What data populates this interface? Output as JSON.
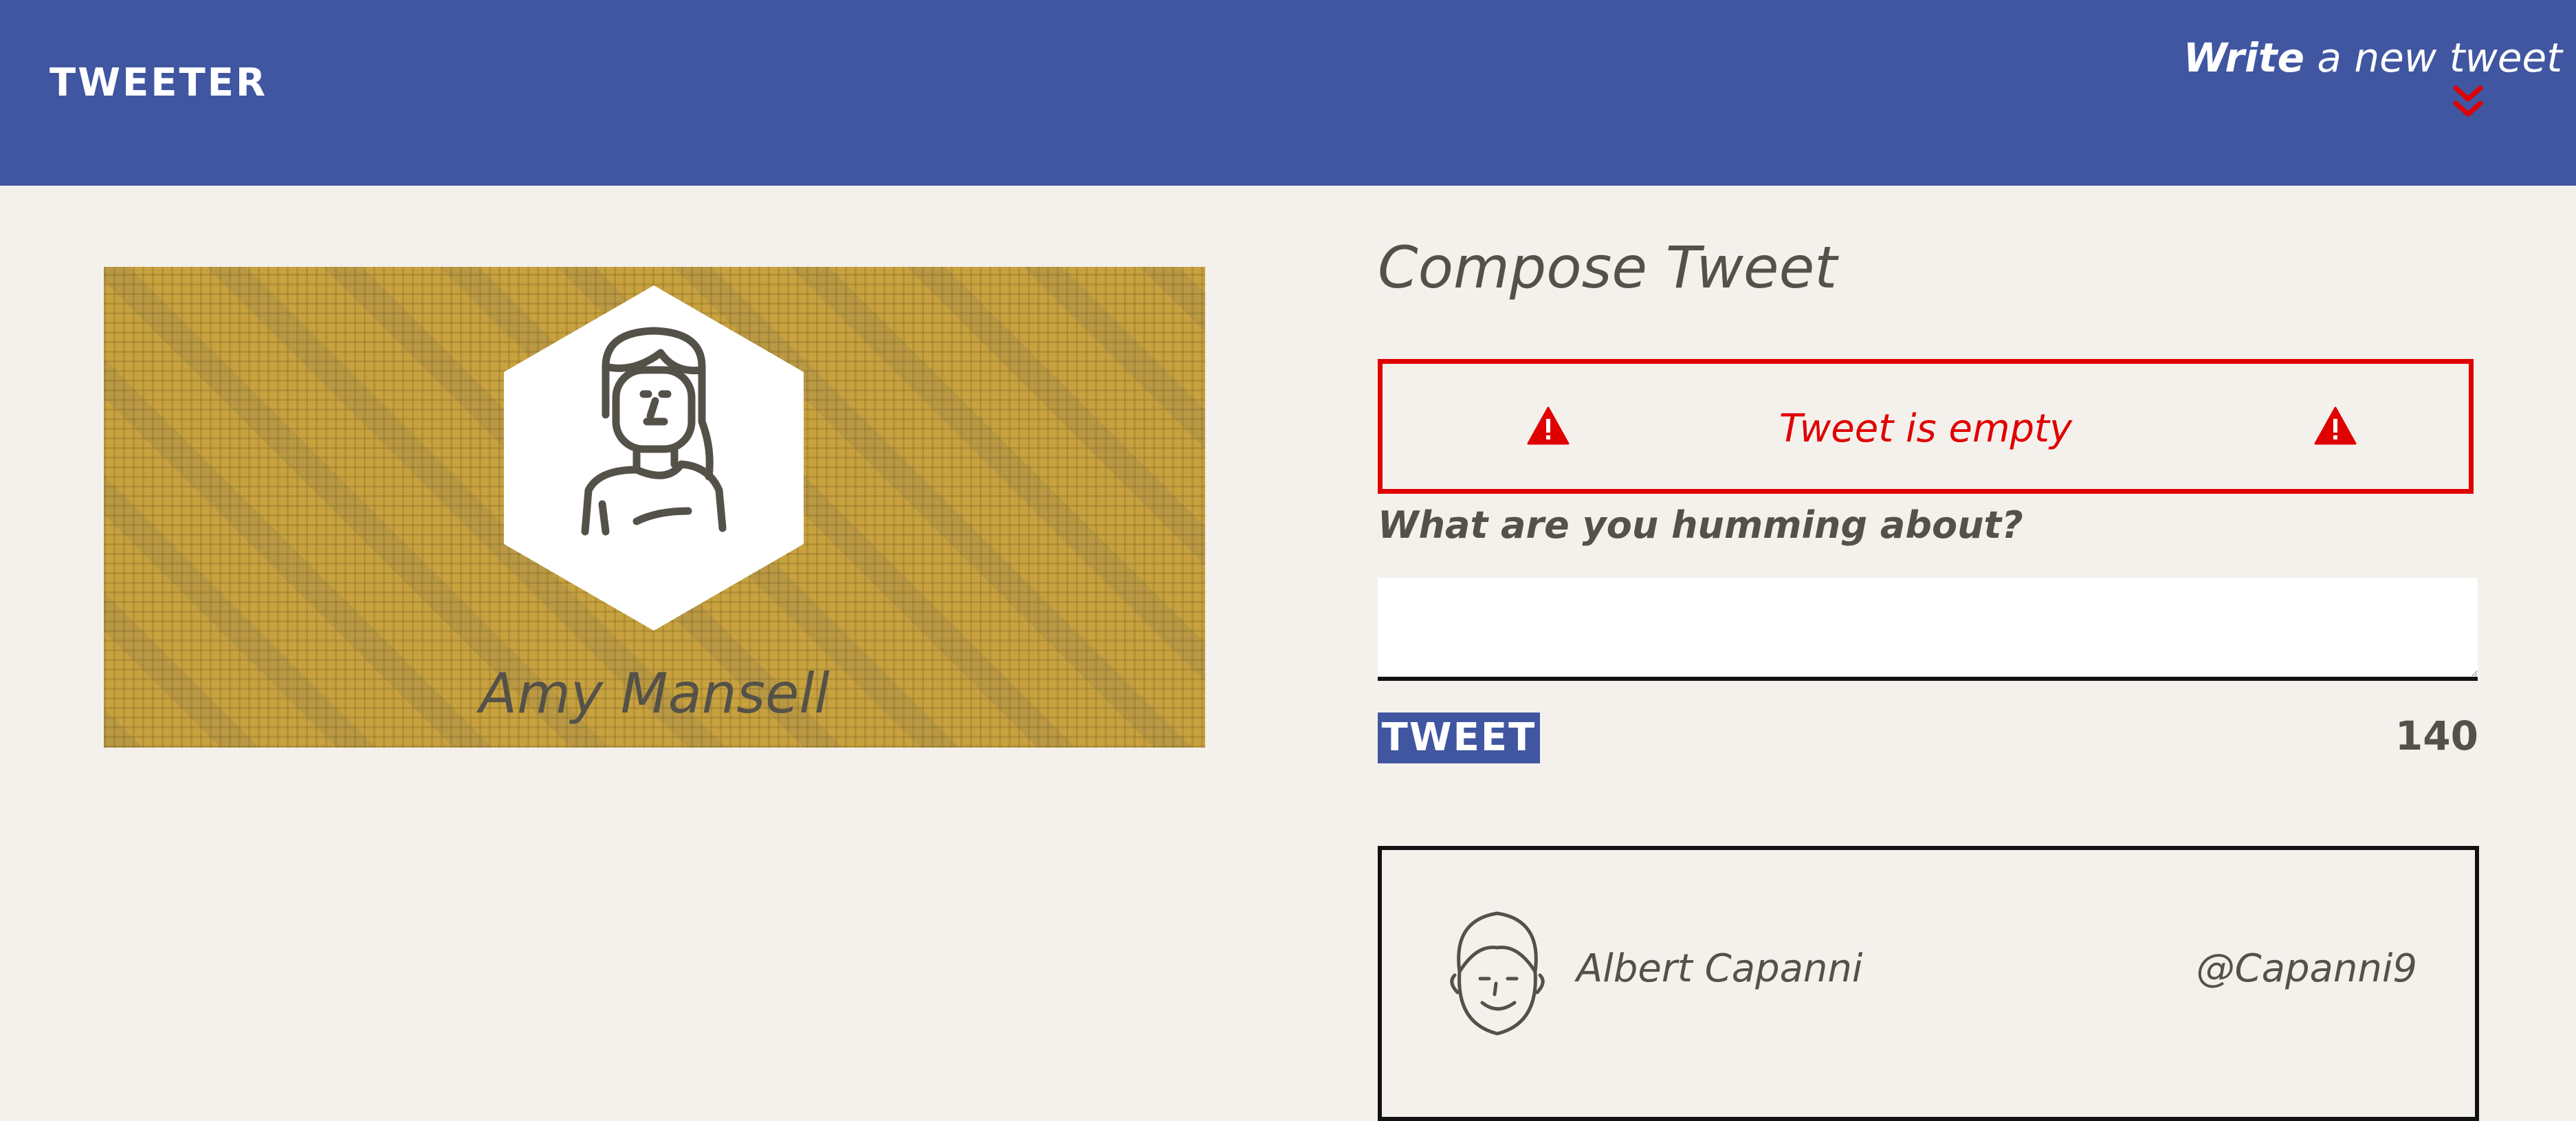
{
  "navbar": {
    "brand": "TWEETER",
    "write_bold": "Write",
    "write_rest": " a new tweet",
    "accent_color": "#e00000",
    "background_color": "#4056a1"
  },
  "profile": {
    "name": "Amy Mansell",
    "avatar_icon": "woman-avatar-icon",
    "background_color": "#c8a23f"
  },
  "compose": {
    "title": "Compose Tweet",
    "error_message": "Tweet is empty",
    "error_icon": "warning-icon",
    "error_color": "#e00000",
    "prompt": "What are you humming about?",
    "input_value": "",
    "button_label": "TWEET",
    "char_count": "140"
  },
  "tweets": [
    {
      "author": "Albert Capanni",
      "handle": "@Capanni9",
      "avatar_icon": "man-avatar-icon"
    }
  ]
}
